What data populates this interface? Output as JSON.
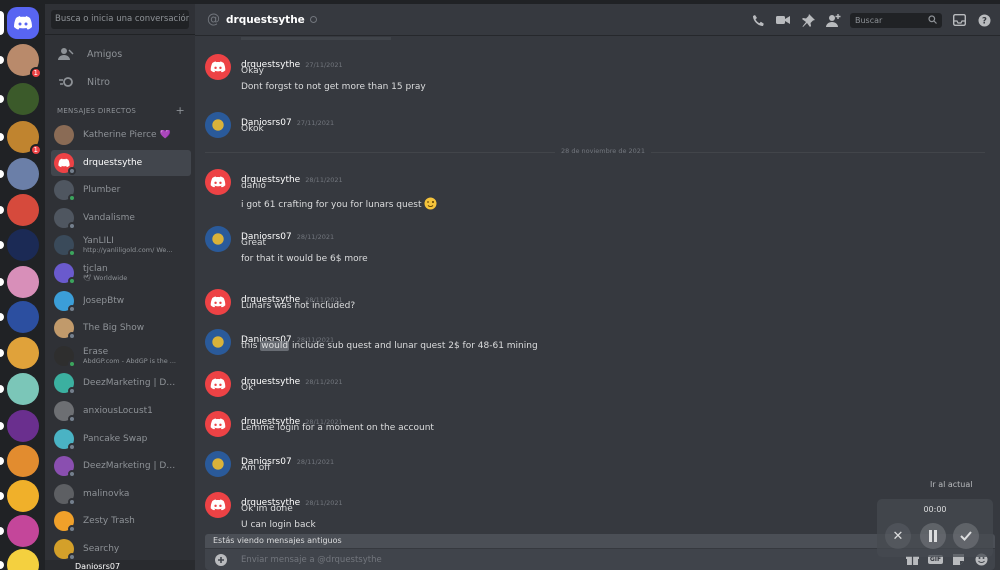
{
  "guilds": {
    "items": [
      {
        "name": "discord-home-icon",
        "color": "#5865f2",
        "badge": ""
      },
      {
        "name": "server-1",
        "color": "#b98a6b",
        "badge": "1"
      },
      {
        "name": "server-2",
        "color": "#3b5a2a",
        "badge": ""
      },
      {
        "name": "server-3",
        "color": "#c0842f",
        "badge": "1"
      },
      {
        "name": "server-4",
        "color": "#6b7fa8",
        "badge": ""
      },
      {
        "name": "server-5",
        "color": "#d64a3c",
        "badge": ""
      },
      {
        "name": "server-6",
        "color": "#1b2a55",
        "badge": ""
      },
      {
        "name": "server-7",
        "color": "#d88fb9",
        "badge": ""
      },
      {
        "name": "server-8",
        "color": "#2c4fa0",
        "badge": ""
      },
      {
        "name": "server-9",
        "color": "#e0a23a",
        "badge": ""
      },
      {
        "name": "server-10",
        "color": "#7bc6b8",
        "badge": ""
      },
      {
        "name": "server-11",
        "color": "#6a2f8e",
        "badge": ""
      },
      {
        "name": "server-12",
        "color": "#e28c2f",
        "badge": ""
      },
      {
        "name": "server-13",
        "color": "#f0b02a",
        "badge": ""
      },
      {
        "name": "server-14",
        "color": "#c4469a",
        "badge": ""
      },
      {
        "name": "server-15",
        "color": "#f4d03f",
        "badge": ""
      }
    ]
  },
  "dm": {
    "search_placeholder": "Busca o inicia una conversación",
    "nav": [
      {
        "label": "Amigos",
        "icon": "friends-icon"
      },
      {
        "label": "Nitro",
        "icon": "nitro-icon"
      }
    ],
    "header": "MENSAJES DIRECTOS",
    "add": "+",
    "items": [
      {
        "name": "Katherine Pierce",
        "sub": "",
        "color": "#8a6b55",
        "status": "none",
        "extra": "💜"
      },
      {
        "name": "drquestsythe",
        "sub": "",
        "color": "#ed4245",
        "status": "off",
        "active": true
      },
      {
        "name": "Plumber",
        "sub": "",
        "color": "#4f5660",
        "status": "on"
      },
      {
        "name": "Vandalisme",
        "sub": "",
        "color": "#4f5660",
        "status": "off"
      },
      {
        "name": "YanLILI",
        "sub": "http://yanliligold.com/ We...",
        "color": "#3a4a5a",
        "status": "on"
      },
      {
        "name": "tjclan",
        "sub": "🕊 Worldwide",
        "color": "#6a5acd",
        "status": "on"
      },
      {
        "name": "JosepBtw",
        "sub": "",
        "color": "#3b9ed8",
        "status": "off"
      },
      {
        "name": "The Big Show",
        "sub": "",
        "color": "#c19a6b",
        "status": "off"
      },
      {
        "name": "Erase",
        "sub": "AbdGP.com - AbdGP is the ...",
        "color": "#2e2e2e",
        "status": "on"
      },
      {
        "name": "DeezMarketing | DM i...",
        "sub": "",
        "color": "#3bb0a0",
        "status": "off"
      },
      {
        "name": "anxiousLocust1",
        "sub": "",
        "color": "#6d6f73",
        "status": "off"
      },
      {
        "name": "Pancake Swap",
        "sub": "",
        "color": "#4ab3c4",
        "status": "off"
      },
      {
        "name": "DeezMarketing | DM i...",
        "sub": "",
        "color": "#8a4fb0",
        "status": "off"
      },
      {
        "name": "malinovka",
        "sub": "",
        "color": "#5d5f63",
        "status": "off"
      },
      {
        "name": "Zesty Trash",
        "sub": "",
        "color": "#f0a02a",
        "status": "off"
      },
      {
        "name": "Searchy",
        "sub": "",
        "color": "#d4a02a",
        "status": "off"
      }
    ],
    "user": "Daniosrs07"
  },
  "channel": {
    "prefix": "@",
    "name": "drquestsythe",
    "search_placeholder": "Buscar",
    "icons": [
      "phone-call-icon",
      "video-call-icon",
      "pin-icon",
      "add-friend-icon",
      "search-icon",
      "inbox-icon",
      "help-icon"
    ]
  },
  "date_separator": "28 de noviembre de 2021",
  "messages": [
    {
      "author": "drquestsythe",
      "time": "27/11/2021",
      "lines": [
        "Okay",
        "Dont forgst to not get more than 15 pray"
      ],
      "kind": "discord"
    },
    {
      "author": "Daniosrs07",
      "time": "27/11/2021",
      "lines": [
        "Okok"
      ],
      "kind": "dani"
    },
    {
      "author": "drquestsythe",
      "time": "28/11/2021",
      "lines": [
        "danio",
        "i got 61 crafting for you for lunars quest 😉"
      ],
      "kind": "discord"
    },
    {
      "author": "Daniosrs07",
      "time": "28/11/2021",
      "lines": [
        "Great",
        "for that it would be 6$ more"
      ],
      "kind": "dani"
    },
    {
      "author": "drquestsythe",
      "time": "28/11/2021",
      "lines": [
        "Lunars was not included?"
      ],
      "kind": "discord"
    },
    {
      "author": "Daniosrs07",
      "time": "28/11/2021",
      "lines": [
        "this would include sub quest and  lunar quest 2$ for 48-61 mining"
      ],
      "kind": "dani",
      "highlight": "would"
    },
    {
      "author": "drquestsythe",
      "time": "28/11/2021",
      "lines": [
        "Ok"
      ],
      "kind": "discord"
    },
    {
      "author": "drquestsythe",
      "time": "28/11/2021",
      "lines": [
        "Lemme login for a moment on the account"
      ],
      "kind": "discord"
    },
    {
      "author": "Daniosrs07",
      "time": "28/11/2021",
      "lines": [
        "Am off"
      ],
      "kind": "dani"
    },
    {
      "author": "drquestsythe",
      "time": "28/11/2021",
      "lines": [
        "Ok im done",
        "U can login back"
      ],
      "kind": "discord"
    }
  ],
  "old_messages_bar": "Estás viendo mensajes antiguos",
  "composer": {
    "placeholder": "Enviar mensaje a @drquestsythe",
    "icons": [
      "gift-icon",
      "gif-icon",
      "sticker-icon",
      "emoji-icon"
    ],
    "gif_label": "GIF"
  },
  "overlay": {
    "timer": "00:00",
    "behind_text": "Ir al actual"
  },
  "colors": {
    "accent": "#5865f2",
    "discord_red": "#ed4245",
    "online": "#3ba55d"
  }
}
